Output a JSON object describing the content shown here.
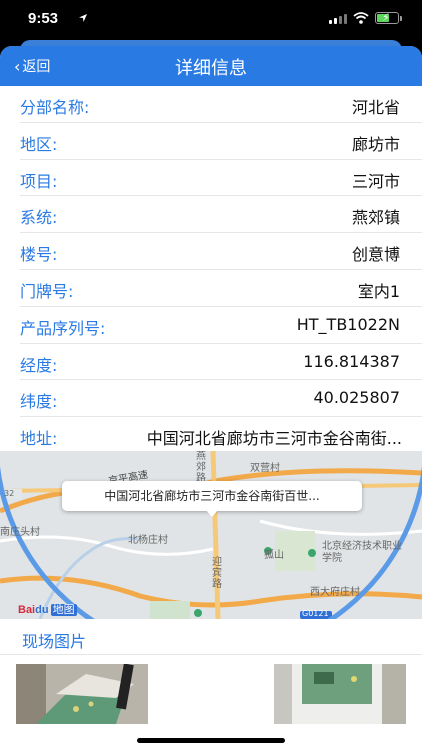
{
  "status": {
    "time": "9:53"
  },
  "nav": {
    "back_label": "返回",
    "title": "详细信息"
  },
  "rows": [
    {
      "label": "分部名称:",
      "value": "河北省"
    },
    {
      "label": "地区:",
      "value": "廊坊市"
    },
    {
      "label": "项目:",
      "value": "三河市"
    },
    {
      "label": "系统:",
      "value": "燕郊镇"
    },
    {
      "label": "楼号:",
      "value": "创意博"
    },
    {
      "label": "门牌号:",
      "value": "室内1"
    },
    {
      "label": "产品序列号:",
      "value": "HT_TB1022N"
    },
    {
      "label": "经度:",
      "value": "116.814387"
    },
    {
      "label": "纬度:",
      "value": "40.025807"
    },
    {
      "label": "地址:",
      "value": "中国河北省廊坊市三河市金谷南街..."
    }
  ],
  "map": {
    "callout": "中国河北省廊坊市三河市金谷南街百世...",
    "labels": {
      "jingping": "京平高速",
      "yanjiao": "燕郊路",
      "shuangying": "双营村",
      "beiyangzhuang": "北杨庄村",
      "nantou": "南庄头村",
      "yingbin": "迎宾路",
      "zhuashan": "孤山",
      "school": "北京经济技术职业学院",
      "xida": "西大府庄村",
      "g0121": "G0121",
      "g32": "32"
    },
    "logo_text_1": "Bai",
    "logo_text_2": "du",
    "logo_text_3": "地图"
  },
  "photos": {
    "label": "现场图片"
  }
}
